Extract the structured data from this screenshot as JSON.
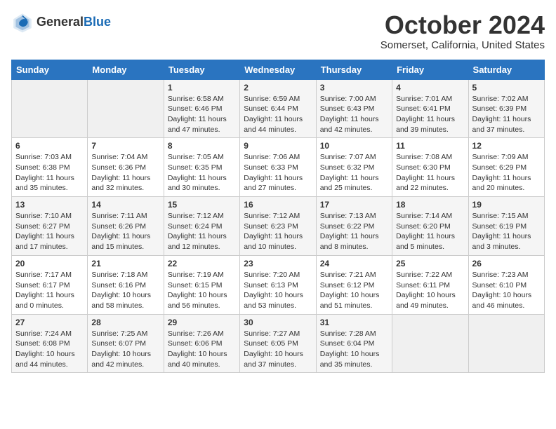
{
  "header": {
    "logo_line1": "General",
    "logo_line2": "Blue",
    "month_title": "October 2024",
    "location": "Somerset, California, United States"
  },
  "days_of_week": [
    "Sunday",
    "Monday",
    "Tuesday",
    "Wednesday",
    "Thursday",
    "Friday",
    "Saturday"
  ],
  "weeks": [
    [
      {
        "day": "",
        "sunrise": "",
        "sunset": "",
        "daylight": ""
      },
      {
        "day": "",
        "sunrise": "",
        "sunset": "",
        "daylight": ""
      },
      {
        "day": "1",
        "sunrise": "Sunrise: 6:58 AM",
        "sunset": "Sunset: 6:46 PM",
        "daylight": "Daylight: 11 hours and 47 minutes."
      },
      {
        "day": "2",
        "sunrise": "Sunrise: 6:59 AM",
        "sunset": "Sunset: 6:44 PM",
        "daylight": "Daylight: 11 hours and 44 minutes."
      },
      {
        "day": "3",
        "sunrise": "Sunrise: 7:00 AM",
        "sunset": "Sunset: 6:43 PM",
        "daylight": "Daylight: 11 hours and 42 minutes."
      },
      {
        "day": "4",
        "sunrise": "Sunrise: 7:01 AM",
        "sunset": "Sunset: 6:41 PM",
        "daylight": "Daylight: 11 hours and 39 minutes."
      },
      {
        "day": "5",
        "sunrise": "Sunrise: 7:02 AM",
        "sunset": "Sunset: 6:39 PM",
        "daylight": "Daylight: 11 hours and 37 minutes."
      }
    ],
    [
      {
        "day": "6",
        "sunrise": "Sunrise: 7:03 AM",
        "sunset": "Sunset: 6:38 PM",
        "daylight": "Daylight: 11 hours and 35 minutes."
      },
      {
        "day": "7",
        "sunrise": "Sunrise: 7:04 AM",
        "sunset": "Sunset: 6:36 PM",
        "daylight": "Daylight: 11 hours and 32 minutes."
      },
      {
        "day": "8",
        "sunrise": "Sunrise: 7:05 AM",
        "sunset": "Sunset: 6:35 PM",
        "daylight": "Daylight: 11 hours and 30 minutes."
      },
      {
        "day": "9",
        "sunrise": "Sunrise: 7:06 AM",
        "sunset": "Sunset: 6:33 PM",
        "daylight": "Daylight: 11 hours and 27 minutes."
      },
      {
        "day": "10",
        "sunrise": "Sunrise: 7:07 AM",
        "sunset": "Sunset: 6:32 PM",
        "daylight": "Daylight: 11 hours and 25 minutes."
      },
      {
        "day": "11",
        "sunrise": "Sunrise: 7:08 AM",
        "sunset": "Sunset: 6:30 PM",
        "daylight": "Daylight: 11 hours and 22 minutes."
      },
      {
        "day": "12",
        "sunrise": "Sunrise: 7:09 AM",
        "sunset": "Sunset: 6:29 PM",
        "daylight": "Daylight: 11 hours and 20 minutes."
      }
    ],
    [
      {
        "day": "13",
        "sunrise": "Sunrise: 7:10 AM",
        "sunset": "Sunset: 6:27 PM",
        "daylight": "Daylight: 11 hours and 17 minutes."
      },
      {
        "day": "14",
        "sunrise": "Sunrise: 7:11 AM",
        "sunset": "Sunset: 6:26 PM",
        "daylight": "Daylight: 11 hours and 15 minutes."
      },
      {
        "day": "15",
        "sunrise": "Sunrise: 7:12 AM",
        "sunset": "Sunset: 6:24 PM",
        "daylight": "Daylight: 11 hours and 12 minutes."
      },
      {
        "day": "16",
        "sunrise": "Sunrise: 7:12 AM",
        "sunset": "Sunset: 6:23 PM",
        "daylight": "Daylight: 11 hours and 10 minutes."
      },
      {
        "day": "17",
        "sunrise": "Sunrise: 7:13 AM",
        "sunset": "Sunset: 6:22 PM",
        "daylight": "Daylight: 11 hours and 8 minutes."
      },
      {
        "day": "18",
        "sunrise": "Sunrise: 7:14 AM",
        "sunset": "Sunset: 6:20 PM",
        "daylight": "Daylight: 11 hours and 5 minutes."
      },
      {
        "day": "19",
        "sunrise": "Sunrise: 7:15 AM",
        "sunset": "Sunset: 6:19 PM",
        "daylight": "Daylight: 11 hours and 3 minutes."
      }
    ],
    [
      {
        "day": "20",
        "sunrise": "Sunrise: 7:17 AM",
        "sunset": "Sunset: 6:17 PM",
        "daylight": "Daylight: 11 hours and 0 minutes."
      },
      {
        "day": "21",
        "sunrise": "Sunrise: 7:18 AM",
        "sunset": "Sunset: 6:16 PM",
        "daylight": "Daylight: 10 hours and 58 minutes."
      },
      {
        "day": "22",
        "sunrise": "Sunrise: 7:19 AM",
        "sunset": "Sunset: 6:15 PM",
        "daylight": "Daylight: 10 hours and 56 minutes."
      },
      {
        "day": "23",
        "sunrise": "Sunrise: 7:20 AM",
        "sunset": "Sunset: 6:13 PM",
        "daylight": "Daylight: 10 hours and 53 minutes."
      },
      {
        "day": "24",
        "sunrise": "Sunrise: 7:21 AM",
        "sunset": "Sunset: 6:12 PM",
        "daylight": "Daylight: 10 hours and 51 minutes."
      },
      {
        "day": "25",
        "sunrise": "Sunrise: 7:22 AM",
        "sunset": "Sunset: 6:11 PM",
        "daylight": "Daylight: 10 hours and 49 minutes."
      },
      {
        "day": "26",
        "sunrise": "Sunrise: 7:23 AM",
        "sunset": "Sunset: 6:10 PM",
        "daylight": "Daylight: 10 hours and 46 minutes."
      }
    ],
    [
      {
        "day": "27",
        "sunrise": "Sunrise: 7:24 AM",
        "sunset": "Sunset: 6:08 PM",
        "daylight": "Daylight: 10 hours and 44 minutes."
      },
      {
        "day": "28",
        "sunrise": "Sunrise: 7:25 AM",
        "sunset": "Sunset: 6:07 PM",
        "daylight": "Daylight: 10 hours and 42 minutes."
      },
      {
        "day": "29",
        "sunrise": "Sunrise: 7:26 AM",
        "sunset": "Sunset: 6:06 PM",
        "daylight": "Daylight: 10 hours and 40 minutes."
      },
      {
        "day": "30",
        "sunrise": "Sunrise: 7:27 AM",
        "sunset": "Sunset: 6:05 PM",
        "daylight": "Daylight: 10 hours and 37 minutes."
      },
      {
        "day": "31",
        "sunrise": "Sunrise: 7:28 AM",
        "sunset": "Sunset: 6:04 PM",
        "daylight": "Daylight: 10 hours and 35 minutes."
      },
      {
        "day": "",
        "sunrise": "",
        "sunset": "",
        "daylight": ""
      },
      {
        "day": "",
        "sunrise": "",
        "sunset": "",
        "daylight": ""
      }
    ]
  ]
}
